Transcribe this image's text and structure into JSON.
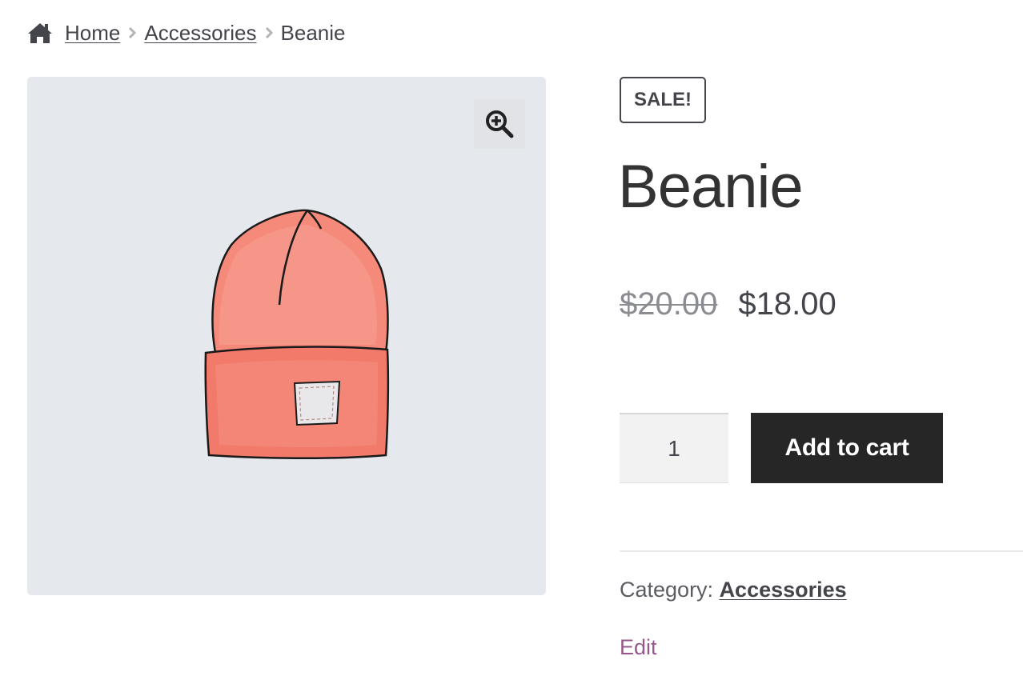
{
  "breadcrumb": {
    "home": "Home",
    "category": "Accessories",
    "current": "Beanie"
  },
  "product": {
    "badge": "SALE!",
    "title": "Beanie",
    "price_regular": "$20.00",
    "price_sale": "$18.00",
    "quantity": "1",
    "add_to_cart_label": "Add to cart",
    "category_label": "Category:",
    "category_value": "Accessories",
    "edit_label": "Edit"
  },
  "icons": {
    "home": "home-icon",
    "separator": "chevron-right-icon",
    "zoom": "zoom-in-icon"
  },
  "colors": {
    "image_background": "#e5e8ed",
    "button_background": "#262626",
    "edit_link": "#96588a",
    "beanie": "#f07a6a"
  }
}
